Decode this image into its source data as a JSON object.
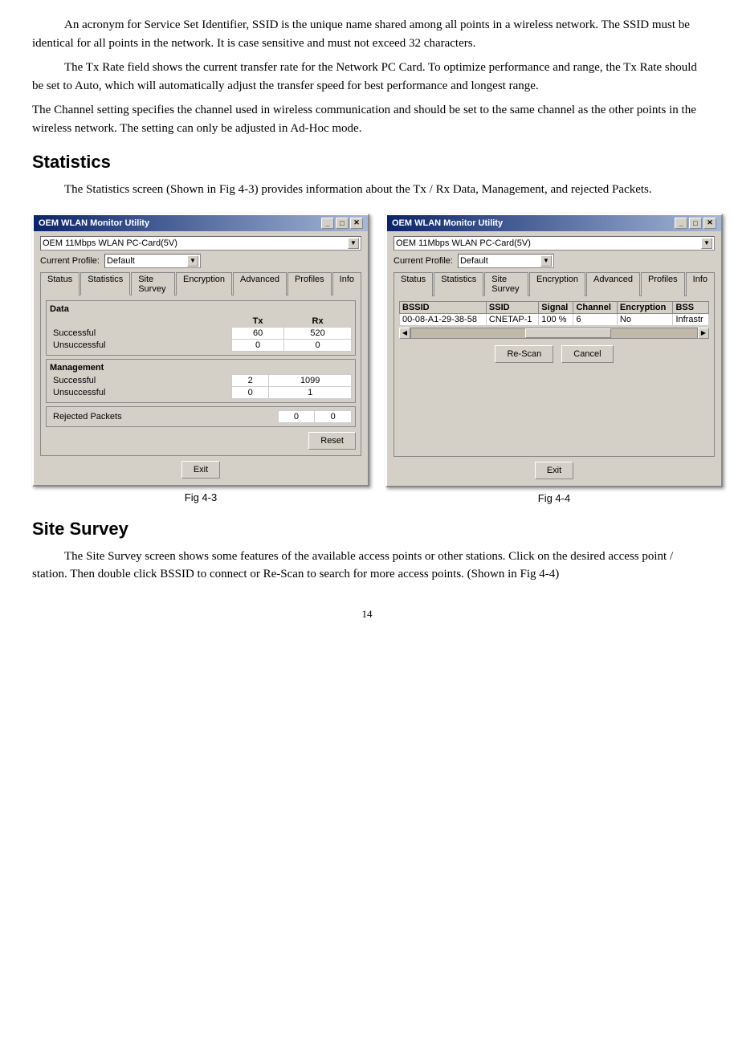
{
  "paragraphs": {
    "p1": "An acronym for Service Set Identifier, SSID is the unique name shared among all points in a wireless network. The SSID must be identical for all points in the network. It is case sensitive and must not exceed 32 characters.",
    "p2": "The Tx Rate field shows the current transfer rate for the Network PC Card. To optimize performance and range, the Tx Rate should be set to  Auto, which will automatically adjust the transfer speed for best performance and longest range.",
    "p3": "The Channel setting specifies the channel used in wireless communication and should be set to the same channel as the other points in the wireless network. The setting can only be adjusted in Ad-Hoc mode."
  },
  "statistics_section": {
    "title": "Statistics",
    "description": "The Statistics screen (Shown in Fig 4-3) provides information about the Tx / Rx Data, Management, and rejected Packets."
  },
  "site_survey_section": {
    "title": "Site Survey",
    "description": "The Site Survey screen shows some features of the available access points or other stations. Click on the desired access point / station. Then double click BSSID to connect or Re-Scan to search for more access points. (Shown in Fig 4-4)"
  },
  "dialog_common": {
    "title": "OEM  WLAN  Monitor Utility",
    "close_btn": "✕",
    "device_label": "OEM 11Mbps WLAN PC-Card(5V)",
    "profile_label": "Current Profile:",
    "profile_value": "Default",
    "dropdown_arrow": "▼"
  },
  "fig3": {
    "caption": "Fig 4-3",
    "tabs": [
      "Status",
      "Statistics",
      "Site Survey",
      "Encryption",
      "Advanced",
      "Profiles",
      "Info"
    ],
    "active_tab": "Statistics",
    "data_section": "Data",
    "management_section": "Management",
    "rejected_label": "Rejected Packets",
    "col_tx": "Tx",
    "col_rx": "Rx",
    "data_rows": [
      {
        "label": "Successful",
        "tx": "60",
        "rx": "520"
      },
      {
        "label": "Unsuccessful",
        "tx": "0",
        "rx": "0"
      }
    ],
    "mgmt_rows": [
      {
        "label": "Successful",
        "tx": "2",
        "rx": "1099"
      },
      {
        "label": "Unsuccessful",
        "tx": "0",
        "rx": "1"
      }
    ],
    "rejected_row": {
      "tx": "0",
      "rx": "0"
    },
    "reset_btn": "Reset",
    "exit_btn": "Exit"
  },
  "fig4": {
    "caption": "Fig 4-4",
    "tabs": [
      "Status",
      "Statistics",
      "Site Survey",
      "Encryption",
      "Advanced",
      "Profiles",
      "Info"
    ],
    "active_tab": "Site Survey",
    "columns": [
      "BSSID",
      "SSID",
      "Signal",
      "Channel",
      "Encryption",
      "BSS"
    ],
    "rows": [
      {
        "bssid": "00-08-A1-29-38-58",
        "ssid": "CNETAP-1",
        "signal": "100 %",
        "channel": "6",
        "encryption": "No",
        "bss": "Infrastr"
      }
    ],
    "rescan_btn": "Re-Scan",
    "cancel_btn": "Cancel",
    "exit_btn": "Exit"
  },
  "page_number": "14"
}
